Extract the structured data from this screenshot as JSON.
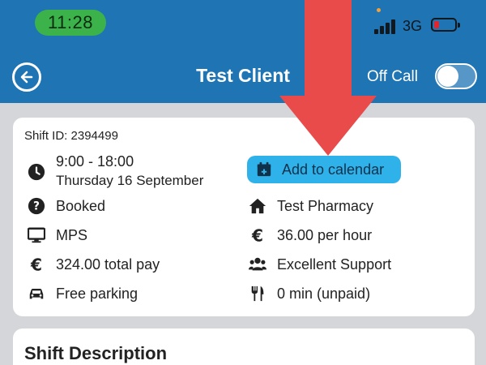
{
  "status_bar": {
    "time": "11:28",
    "network": "3G",
    "battery_level": 0.15
  },
  "header": {
    "title": "Test Client",
    "off_call_label": "Off Call",
    "toggle_on": false
  },
  "shift": {
    "id_label": "Shift ID: 2394499",
    "time_range": "9:00 - 18:00",
    "date": "Thursday 16 September",
    "add_to_calendar": "Add to calendar",
    "status": "Booked",
    "location": "Test Pharmacy",
    "system": "MPS",
    "rate": "36.00 per hour",
    "total_pay": "324.00 total pay",
    "support": "Excellent Support",
    "parking": "Free parking",
    "break": "0 min (unpaid)"
  },
  "description": {
    "title": "Shift Description"
  },
  "colors": {
    "header": "#1f74b4",
    "background": "#d4d6d9",
    "calendar_button": "#2fb1ea",
    "arrow": "#e94b4b",
    "time_pill": "#3cb34a"
  },
  "icons": {
    "back": "arrow-left-circle-icon",
    "clock": "clock-icon",
    "calendar": "calendar-plus-icon",
    "status": "question-circle-icon",
    "location": "home-icon",
    "system": "desktop-icon",
    "rate": "euro-icon",
    "pay": "euro-icon",
    "support": "users-icon",
    "parking": "car-icon",
    "break": "utensils-icon"
  }
}
